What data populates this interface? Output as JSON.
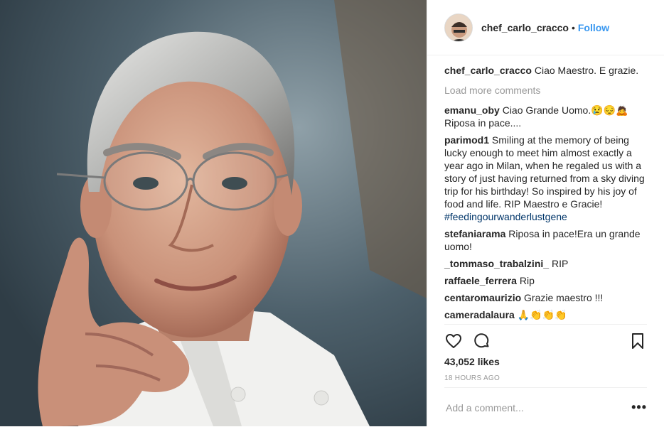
{
  "post": {
    "image_alt": "Portrait of an older chef with silver hair and glasses, chin resting on hand"
  },
  "header": {
    "username": "chef_carlo_cracco",
    "separator": "•",
    "follow_label": "Follow"
  },
  "caption": {
    "username": "chef_carlo_cracco",
    "text": "Ciao Maestro. E grazie."
  },
  "load_more": "Load more comments",
  "comments": [
    {
      "user": "emanu_oby",
      "text": "Ciao Grande Uomo.😢😔🙇 Riposa in pace...."
    },
    {
      "user": "parimod1",
      "text": "Smiling at the memory of being lucky enough to meet him almost exactly a year ago in Milan, when he regaled us with a story of just having returned from a sky diving trip for his birthday! So inspired by his joy of food and life. RIP Maestro e Gracie! ",
      "hashtag": "#feedingourwanderlustgene"
    },
    {
      "user": "stefaniarama",
      "text": "Riposa in pace!Era un grande uomo!"
    },
    {
      "user": "_tommaso_trabalzini_",
      "text": "RIP"
    },
    {
      "user": "raffaele_ferrera",
      "text": "Rip"
    },
    {
      "user": "centaromaurizio",
      "text": "Grazie maestro !!!"
    },
    {
      "user": "cameradalaura",
      "text": "🙏👏👏👏"
    }
  ],
  "likes": "43,052 likes",
  "timestamp": "18 HOURS AGO",
  "add_comment": {
    "placeholder": "Add a comment..."
  },
  "more_label": "•••",
  "icons": {
    "like": "heart-icon",
    "comment": "comment-icon",
    "save": "bookmark-icon",
    "more": "more-options-icon"
  },
  "colors": {
    "link": "#3897f0",
    "hashtag": "#003569",
    "muted": "#999999"
  }
}
